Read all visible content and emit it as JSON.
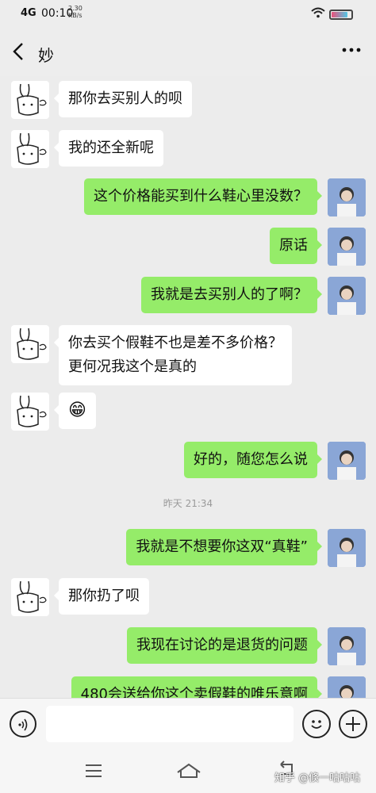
{
  "status_bar": {
    "network": "4G",
    "time": "00:10",
    "speed_value": "2.30",
    "speed_unit": "KB/s"
  },
  "header": {
    "back_icon": "chevron-left-icon",
    "title": "妙",
    "more_icon": "more-dots-icon"
  },
  "messages": [
    {
      "side": "left",
      "text": "那你去买别人的呗"
    },
    {
      "side": "left",
      "text": "我的还全新呢"
    },
    {
      "side": "right",
      "text": "这个价格能买到什么鞋心里没数？"
    },
    {
      "side": "right",
      "text": "原话"
    },
    {
      "side": "right",
      "text": "我就是去买别人的了啊？"
    },
    {
      "side": "left",
      "text": "你去买个假鞋不也是差不多价格？",
      "text2": "更何况我这个是真的"
    },
    {
      "side": "left",
      "text": "😁"
    },
    {
      "side": "right",
      "text": "好的，随您怎么说"
    },
    {
      "side": "right",
      "text": "我就是不想要你这双“真鞋”"
    },
    {
      "side": "left",
      "text": "那你扔了呗"
    },
    {
      "side": "right",
      "text": "我现在讨论的是退货的问题"
    },
    {
      "side": "right",
      "text": "480会送给你这个卖假鞋的唯乐意啊"
    }
  ],
  "timestamp": "昨天 21:34",
  "input_bar": {
    "voice_icon": "voice-icon",
    "emoji_icon": "emoji-icon",
    "plus_icon": "plus-icon"
  },
  "nav_bar": {
    "watermark": "知乎 @倏一咕咕咕"
  },
  "colors": {
    "self_bubble": "#95ec69",
    "other_bubble": "#ffffff",
    "background": "#ececec"
  }
}
